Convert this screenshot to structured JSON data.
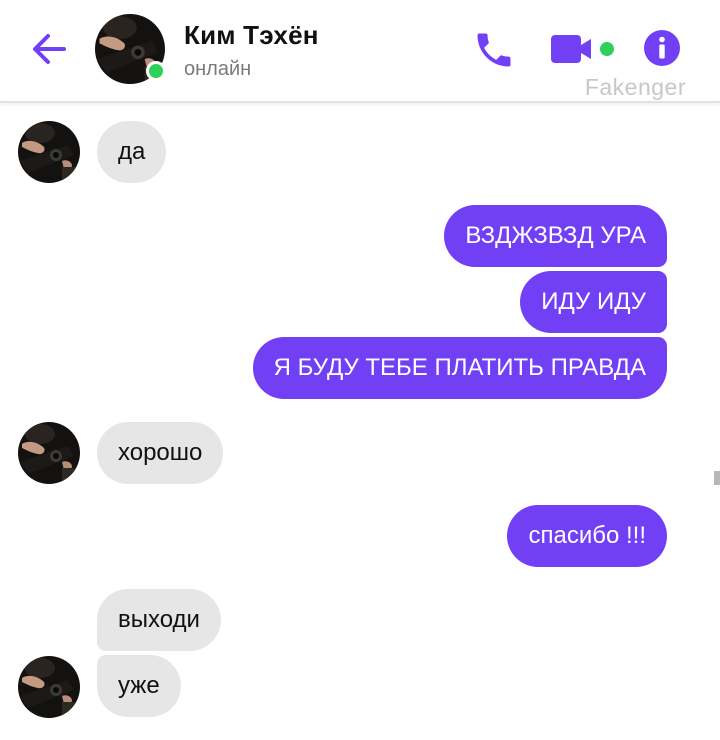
{
  "header": {
    "name": "Ким Тэхён",
    "status": "онлайн",
    "watermark": "Fakenger",
    "icons": {
      "back": "arrow-left-icon",
      "call": "phone-icon",
      "video": "video-camera-icon",
      "info": "info-icon"
    }
  },
  "colors": {
    "accent": "#7140f4",
    "incoming_bubble": "#e6e6e6",
    "online": "#2ed15a"
  },
  "messages": [
    {
      "direction": "in",
      "text": "да"
    },
    {
      "direction": "out",
      "text": "ВЗДЖЗВЗД УРА"
    },
    {
      "direction": "out",
      "text": "ИДУ ИДУ"
    },
    {
      "direction": "out",
      "text": "Я БУДУ ТЕБЕ ПЛАТИТЬ ПРАВДА"
    },
    {
      "direction": "in",
      "text": "хорошо"
    },
    {
      "direction": "out",
      "text": "спасибо !!!"
    },
    {
      "direction": "in",
      "text": "выходи"
    },
    {
      "direction": "in",
      "text": "уже"
    }
  ]
}
